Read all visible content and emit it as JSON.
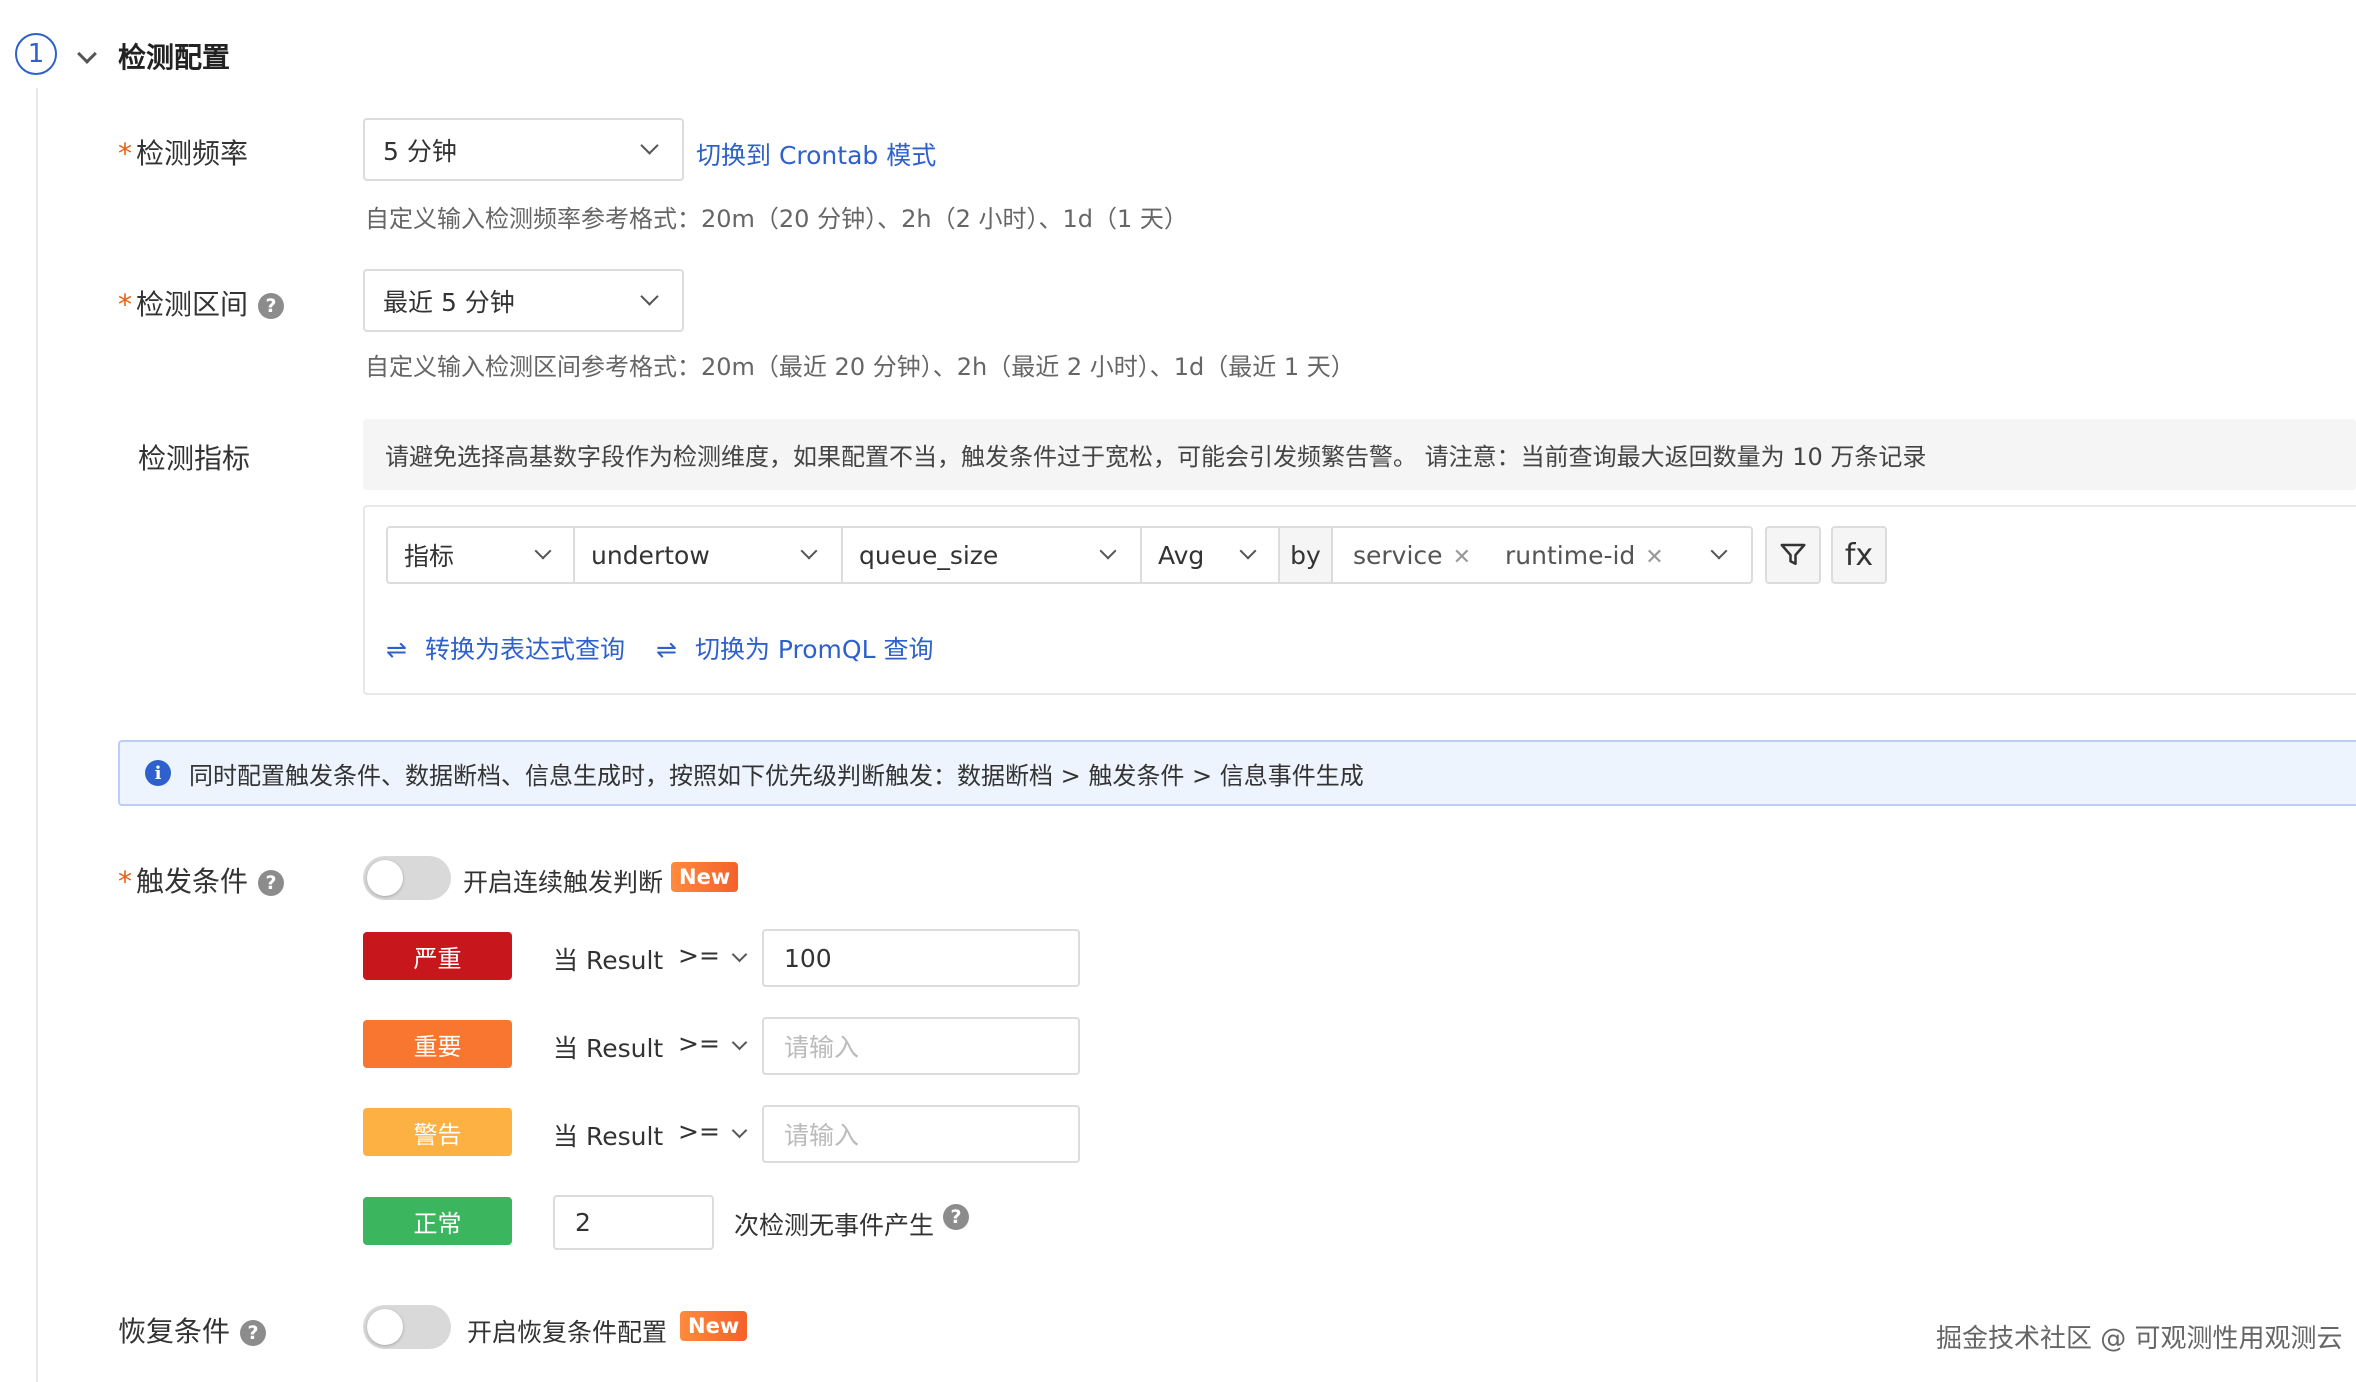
{
  "section": {
    "step": "1",
    "title": "检测配置"
  },
  "frequency": {
    "label": "检测频率",
    "value": "5 分钟",
    "switch_link": "切换到 Crontab 模式",
    "hint": "自定义输入检测频率参考格式：20m（20 分钟）、2h（2 小时）、1d（1 天）"
  },
  "interval": {
    "label": "检测区间",
    "value": "最近 5 分钟",
    "hint": "自定义输入检测区间参考格式：20m（最近 20 分钟）、2h（最近 2 小时）、1d（最近 1 天）"
  },
  "metric": {
    "label": "检测指标",
    "notice": "请避免选择高基数字段作为检测维度，如果配置不当，触发条件过于宽松，可能会引发频繁告警。 请注意：当前查询最大返回数量为 10 万条记录",
    "type": "指标",
    "measurement": "undertow",
    "field": "queue_size",
    "aggregation": "Avg",
    "by_label": "by",
    "group_tags": [
      "service",
      "runtime-id"
    ],
    "fx_label": "fx",
    "convert_expression_link": "转换为表达式查询",
    "switch_promql_link": "切换为 PromQL 查询"
  },
  "info_bar": {
    "text": "同时配置触发条件、数据断档、信息生成时，按照如下优先级判断触发：数据断档 > 触发条件 > 信息事件生成"
  },
  "trigger": {
    "label": "触发条件",
    "toggle_label": "开启连续触发判断",
    "new_badge": "New",
    "levels": [
      {
        "name": "严重",
        "color": "#c8161d",
        "when": "当 Result",
        "op": ">=",
        "value": "100",
        "placeholder": "请输入"
      },
      {
        "name": "重要",
        "color": "#f8762f",
        "when": "当 Result",
        "op": ">=",
        "value": "",
        "placeholder": "请输入"
      },
      {
        "name": "警告",
        "color": "#fcb142",
        "when": "当 Result",
        "op": ">=",
        "value": "",
        "placeholder": "请输入"
      }
    ],
    "normal": {
      "name": "正常",
      "color": "#3cb55f",
      "count": "2",
      "text": "次检测无事件产生"
    }
  },
  "recovery": {
    "label": "恢复条件",
    "toggle_label": "开启恢复条件配置",
    "new_badge": "New"
  },
  "watermark": "掘金技术社区 @ 可观测性用观测云"
}
